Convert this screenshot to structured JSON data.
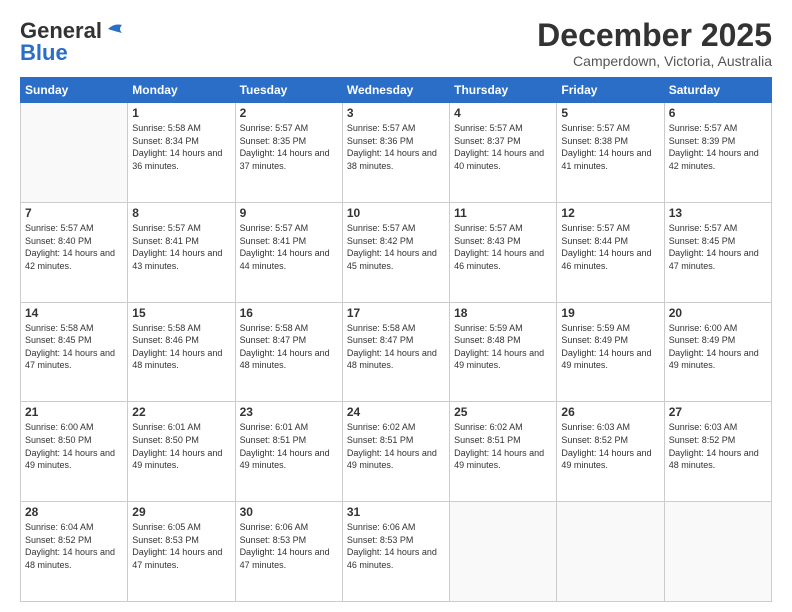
{
  "header": {
    "logo_general": "General",
    "logo_blue": "Blue",
    "month_title": "December 2025",
    "subtitle": "Camperdown, Victoria, Australia"
  },
  "days_of_week": [
    "Sunday",
    "Monday",
    "Tuesday",
    "Wednesday",
    "Thursday",
    "Friday",
    "Saturday"
  ],
  "weeks": [
    [
      {
        "day": "",
        "empty": true
      },
      {
        "day": "1",
        "sunrise": "Sunrise: 5:58 AM",
        "sunset": "Sunset: 8:34 PM",
        "daylight": "Daylight: 14 hours and 36 minutes."
      },
      {
        "day": "2",
        "sunrise": "Sunrise: 5:57 AM",
        "sunset": "Sunset: 8:35 PM",
        "daylight": "Daylight: 14 hours and 37 minutes."
      },
      {
        "day": "3",
        "sunrise": "Sunrise: 5:57 AM",
        "sunset": "Sunset: 8:36 PM",
        "daylight": "Daylight: 14 hours and 38 minutes."
      },
      {
        "day": "4",
        "sunrise": "Sunrise: 5:57 AM",
        "sunset": "Sunset: 8:37 PM",
        "daylight": "Daylight: 14 hours and 40 minutes."
      },
      {
        "day": "5",
        "sunrise": "Sunrise: 5:57 AM",
        "sunset": "Sunset: 8:38 PM",
        "daylight": "Daylight: 14 hours and 41 minutes."
      },
      {
        "day": "6",
        "sunrise": "Sunrise: 5:57 AM",
        "sunset": "Sunset: 8:39 PM",
        "daylight": "Daylight: 14 hours and 42 minutes."
      }
    ],
    [
      {
        "day": "7",
        "sunrise": "Sunrise: 5:57 AM",
        "sunset": "Sunset: 8:40 PM",
        "daylight": "Daylight: 14 hours and 42 minutes."
      },
      {
        "day": "8",
        "sunrise": "Sunrise: 5:57 AM",
        "sunset": "Sunset: 8:41 PM",
        "daylight": "Daylight: 14 hours and 43 minutes."
      },
      {
        "day": "9",
        "sunrise": "Sunrise: 5:57 AM",
        "sunset": "Sunset: 8:41 PM",
        "daylight": "Daylight: 14 hours and 44 minutes."
      },
      {
        "day": "10",
        "sunrise": "Sunrise: 5:57 AM",
        "sunset": "Sunset: 8:42 PM",
        "daylight": "Daylight: 14 hours and 45 minutes."
      },
      {
        "day": "11",
        "sunrise": "Sunrise: 5:57 AM",
        "sunset": "Sunset: 8:43 PM",
        "daylight": "Daylight: 14 hours and 46 minutes."
      },
      {
        "day": "12",
        "sunrise": "Sunrise: 5:57 AM",
        "sunset": "Sunset: 8:44 PM",
        "daylight": "Daylight: 14 hours and 46 minutes."
      },
      {
        "day": "13",
        "sunrise": "Sunrise: 5:57 AM",
        "sunset": "Sunset: 8:45 PM",
        "daylight": "Daylight: 14 hours and 47 minutes."
      }
    ],
    [
      {
        "day": "14",
        "sunrise": "Sunrise: 5:58 AM",
        "sunset": "Sunset: 8:45 PM",
        "daylight": "Daylight: 14 hours and 47 minutes."
      },
      {
        "day": "15",
        "sunrise": "Sunrise: 5:58 AM",
        "sunset": "Sunset: 8:46 PM",
        "daylight": "Daylight: 14 hours and 48 minutes."
      },
      {
        "day": "16",
        "sunrise": "Sunrise: 5:58 AM",
        "sunset": "Sunset: 8:47 PM",
        "daylight": "Daylight: 14 hours and 48 minutes."
      },
      {
        "day": "17",
        "sunrise": "Sunrise: 5:58 AM",
        "sunset": "Sunset: 8:47 PM",
        "daylight": "Daylight: 14 hours and 48 minutes."
      },
      {
        "day": "18",
        "sunrise": "Sunrise: 5:59 AM",
        "sunset": "Sunset: 8:48 PM",
        "daylight": "Daylight: 14 hours and 49 minutes."
      },
      {
        "day": "19",
        "sunrise": "Sunrise: 5:59 AM",
        "sunset": "Sunset: 8:49 PM",
        "daylight": "Daylight: 14 hours and 49 minutes."
      },
      {
        "day": "20",
        "sunrise": "Sunrise: 6:00 AM",
        "sunset": "Sunset: 8:49 PM",
        "daylight": "Daylight: 14 hours and 49 minutes."
      }
    ],
    [
      {
        "day": "21",
        "sunrise": "Sunrise: 6:00 AM",
        "sunset": "Sunset: 8:50 PM",
        "daylight": "Daylight: 14 hours and 49 minutes."
      },
      {
        "day": "22",
        "sunrise": "Sunrise: 6:01 AM",
        "sunset": "Sunset: 8:50 PM",
        "daylight": "Daylight: 14 hours and 49 minutes."
      },
      {
        "day": "23",
        "sunrise": "Sunrise: 6:01 AM",
        "sunset": "Sunset: 8:51 PM",
        "daylight": "Daylight: 14 hours and 49 minutes."
      },
      {
        "day": "24",
        "sunrise": "Sunrise: 6:02 AM",
        "sunset": "Sunset: 8:51 PM",
        "daylight": "Daylight: 14 hours and 49 minutes."
      },
      {
        "day": "25",
        "sunrise": "Sunrise: 6:02 AM",
        "sunset": "Sunset: 8:51 PM",
        "daylight": "Daylight: 14 hours and 49 minutes."
      },
      {
        "day": "26",
        "sunrise": "Sunrise: 6:03 AM",
        "sunset": "Sunset: 8:52 PM",
        "daylight": "Daylight: 14 hours and 49 minutes."
      },
      {
        "day": "27",
        "sunrise": "Sunrise: 6:03 AM",
        "sunset": "Sunset: 8:52 PM",
        "daylight": "Daylight: 14 hours and 48 minutes."
      }
    ],
    [
      {
        "day": "28",
        "sunrise": "Sunrise: 6:04 AM",
        "sunset": "Sunset: 8:52 PM",
        "daylight": "Daylight: 14 hours and 48 minutes."
      },
      {
        "day": "29",
        "sunrise": "Sunrise: 6:05 AM",
        "sunset": "Sunset: 8:53 PM",
        "daylight": "Daylight: 14 hours and 47 minutes."
      },
      {
        "day": "30",
        "sunrise": "Sunrise: 6:06 AM",
        "sunset": "Sunset: 8:53 PM",
        "daylight": "Daylight: 14 hours and 47 minutes."
      },
      {
        "day": "31",
        "sunrise": "Sunrise: 6:06 AM",
        "sunset": "Sunset: 8:53 PM",
        "daylight": "Daylight: 14 hours and 46 minutes."
      },
      {
        "day": "",
        "empty": true
      },
      {
        "day": "",
        "empty": true
      },
      {
        "day": "",
        "empty": true
      }
    ]
  ]
}
